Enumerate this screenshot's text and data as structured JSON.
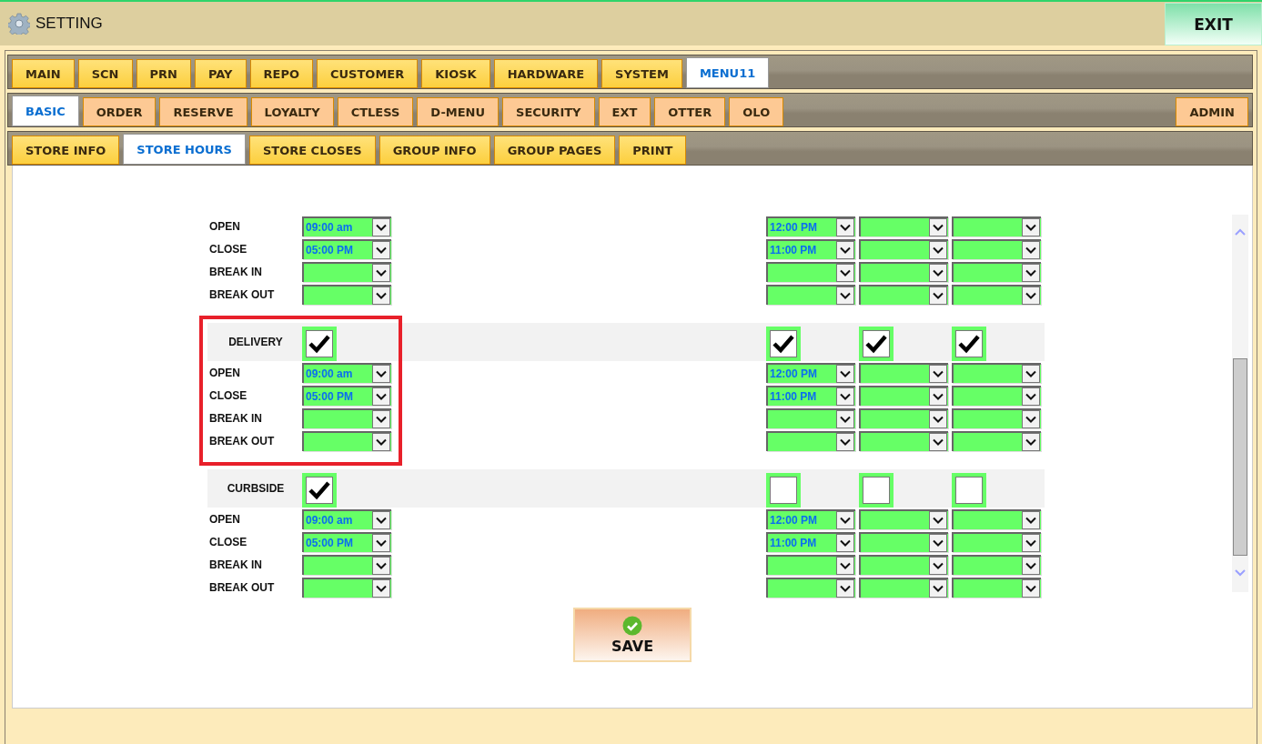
{
  "window": {
    "title": "SETTING",
    "exit": "EXIT"
  },
  "tab_rows": [
    {
      "tabs": [
        {
          "label": "MAIN",
          "selected": false
        },
        {
          "label": "SCN",
          "selected": false
        },
        {
          "label": "PRN",
          "selected": false
        },
        {
          "label": "PAY",
          "selected": false
        },
        {
          "label": "REPO",
          "selected": false
        },
        {
          "label": "CUSTOMER",
          "selected": false
        },
        {
          "label": "KIOSK",
          "selected": false
        },
        {
          "label": "HARDWARE",
          "selected": false
        },
        {
          "label": "SYSTEM",
          "selected": false
        },
        {
          "label": "MENU11",
          "selected": true
        }
      ]
    },
    {
      "tabs": [
        {
          "label": "BASIC",
          "selected": true
        },
        {
          "label": "ORDER",
          "selected": false
        },
        {
          "label": "RESERVE",
          "selected": false
        },
        {
          "label": "LOYALTY",
          "selected": false
        },
        {
          "label": "CTLESS",
          "selected": false
        },
        {
          "label": "D-MENU",
          "selected": false
        },
        {
          "label": "SECURITY",
          "selected": false
        },
        {
          "label": "EXT",
          "selected": false
        },
        {
          "label": "OTTER",
          "selected": false
        },
        {
          "label": "OLO",
          "selected": false
        }
      ],
      "right_tabs": [
        {
          "label": "ADMIN",
          "selected": false
        }
      ]
    },
    {
      "tabs": [
        {
          "label": "STORE INFO",
          "selected": false
        },
        {
          "label": "STORE HOURS",
          "selected": true
        },
        {
          "label": "STORE CLOSES",
          "selected": false
        },
        {
          "label": "GROUP INFO",
          "selected": false
        },
        {
          "label": "GROUP PAGES",
          "selected": false
        },
        {
          "label": "PRINT",
          "selected": false
        }
      ]
    }
  ],
  "sections": [
    {
      "rows": [
        {
          "label": "OPEN",
          "cells": [
            {
              "kind": "time",
              "value": "09:00 am"
            },
            {
              "kind": "time",
              "value": "12:00 PM"
            },
            {
              "kind": "blank"
            },
            {
              "kind": "blank"
            }
          ]
        },
        {
          "label": "CLOSE",
          "cells": [
            {
              "kind": "time",
              "value": "05:00 PM"
            },
            {
              "kind": "time",
              "value": "11:00 PM"
            },
            {
              "kind": "blank"
            },
            {
              "kind": "blank"
            }
          ]
        },
        {
          "label": "BREAK IN",
          "cells": [
            {
              "kind": "blank"
            },
            {
              "kind": "blank"
            },
            {
              "kind": "blank"
            },
            {
              "kind": "blank"
            }
          ]
        },
        {
          "label": "BREAK OUT",
          "cells": [
            {
              "kind": "blank"
            },
            {
              "kind": "blank"
            },
            {
              "kind": "blank"
            },
            {
              "kind": "blank"
            }
          ]
        }
      ]
    },
    {
      "label": "DELIVERY",
      "checks": [
        true,
        true,
        true,
        true
      ],
      "highlighted": true,
      "rows": [
        {
          "label": "OPEN",
          "cells": [
            {
              "kind": "time",
              "value": "09:00 am"
            },
            {
              "kind": "time",
              "value": "12:00 PM"
            },
            {
              "kind": "blank"
            },
            {
              "kind": "blank"
            }
          ]
        },
        {
          "label": "CLOSE",
          "cells": [
            {
              "kind": "time",
              "value": "05:00 PM"
            },
            {
              "kind": "time",
              "value": "11:00 PM"
            },
            {
              "kind": "blank"
            },
            {
              "kind": "blank"
            }
          ]
        },
        {
          "label": "BREAK IN",
          "cells": [
            {
              "kind": "blank"
            },
            {
              "kind": "blank"
            },
            {
              "kind": "blank"
            },
            {
              "kind": "blank"
            }
          ]
        },
        {
          "label": "BREAK OUT",
          "cells": [
            {
              "kind": "blank"
            },
            {
              "kind": "blank"
            },
            {
              "kind": "blank"
            },
            {
              "kind": "blank"
            }
          ]
        }
      ]
    },
    {
      "label": "CURBSIDE",
      "checks": [
        true,
        false,
        false,
        false
      ],
      "rows": [
        {
          "label": "OPEN",
          "cells": [
            {
              "kind": "time",
              "value": "09:00 am"
            },
            {
              "kind": "time",
              "value": "12:00 PM"
            },
            {
              "kind": "blank"
            },
            {
              "kind": "blank"
            }
          ]
        },
        {
          "label": "CLOSE",
          "cells": [
            {
              "kind": "time",
              "value": "05:00 PM"
            },
            {
              "kind": "time",
              "value": "11:00 PM"
            },
            {
              "kind": "blank"
            },
            {
              "kind": "blank"
            }
          ]
        },
        {
          "label": "BREAK IN",
          "cells": [
            {
              "kind": "blank"
            },
            {
              "kind": "blank"
            },
            {
              "kind": "blank"
            },
            {
              "kind": "blank"
            }
          ]
        },
        {
          "label": "BREAK OUT",
          "cells": [
            {
              "kind": "blank"
            },
            {
              "kind": "blank"
            },
            {
              "kind": "blank"
            },
            {
              "kind": "blank"
            }
          ]
        }
      ]
    }
  ],
  "save_button": "SAVE"
}
